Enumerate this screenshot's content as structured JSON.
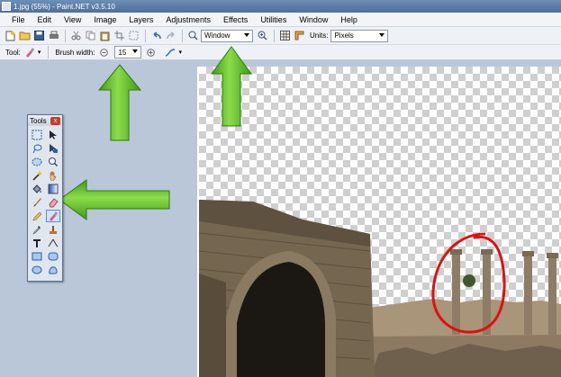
{
  "window": {
    "title": "1.jpg (55%) - Paint.NET v3.5.10"
  },
  "menu": [
    "File",
    "Edit",
    "View",
    "Image",
    "Layers",
    "Adjustments",
    "Effects",
    "Utilities",
    "Window",
    "Help"
  ],
  "toolbar": {
    "zoom_mode": "Window",
    "units_label": "Units:",
    "units_value": "Pixels"
  },
  "tool_options": {
    "tool_label": "Tool:",
    "brush_width_label": "Brush width:",
    "brush_width_value": "15"
  },
  "tools_window": {
    "title": "Tools",
    "close_glyph": "x",
    "selected_tool": "recolor",
    "tools": [
      "rectangle-select",
      "move-selection",
      "lasso-select",
      "move-selected",
      "ellipse-select",
      "zoom",
      "magic-wand",
      "pan",
      "paint-bucket",
      "gradient",
      "paintbrush",
      "eraser",
      "pencil",
      "color-picker",
      "clone-stamp",
      "recolor",
      "text",
      "line-curve",
      "rectangle",
      "rounded-rectangle",
      "ellipse",
      "freeform-shape"
    ]
  },
  "colors": {
    "arrow_green": "#5fbf2a",
    "circle_red": "#e01010"
  }
}
